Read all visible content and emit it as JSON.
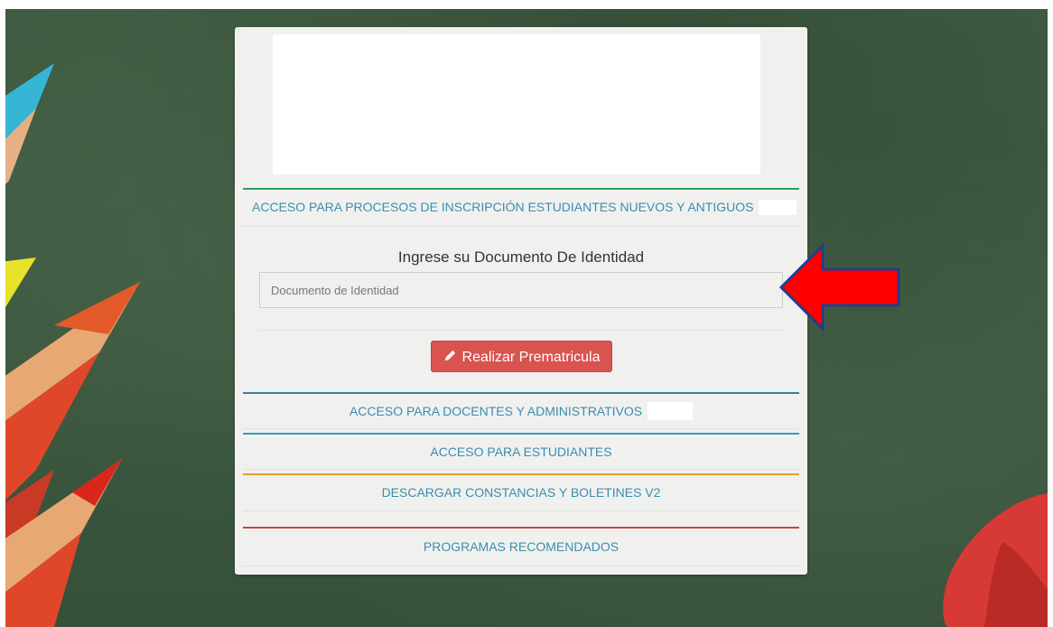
{
  "background": {
    "theme": "chalkboard",
    "color": "#3d5a3e"
  },
  "panel": {
    "logo": "",
    "section_primary": {
      "label": "ACCESO PARA PROCESOS DE INSCRIPCIÓN ESTUDIANTES NUEVOS Y ANTIGUOS",
      "accent": "#2f9b64"
    },
    "prompt": "Ingrese su Documento De Identidad",
    "document_input": {
      "value": "",
      "placeholder": "Documento de Identidad"
    },
    "submit_button": {
      "label": "Realizar Prematricula",
      "icon": "pencil-icon",
      "color": "#d9534f"
    },
    "links": [
      {
        "label": "ACCESO PARA DOCENTES Y ADMINISTRATIVOS",
        "accent": "#3a7ea8"
      },
      {
        "label": "ACCESO PARA ESTUDIANTES",
        "accent": "#2d9dbf"
      },
      {
        "label": "DESCARGAR CONSTANCIAS Y BOLETINES V2",
        "accent": "#e0a028"
      },
      {
        "label": "PROGRAMAS RECOMENDADOS",
        "accent": "#c64541"
      }
    ]
  },
  "annotation": {
    "icon": "red-arrow-icon",
    "color": "#ff0000"
  }
}
